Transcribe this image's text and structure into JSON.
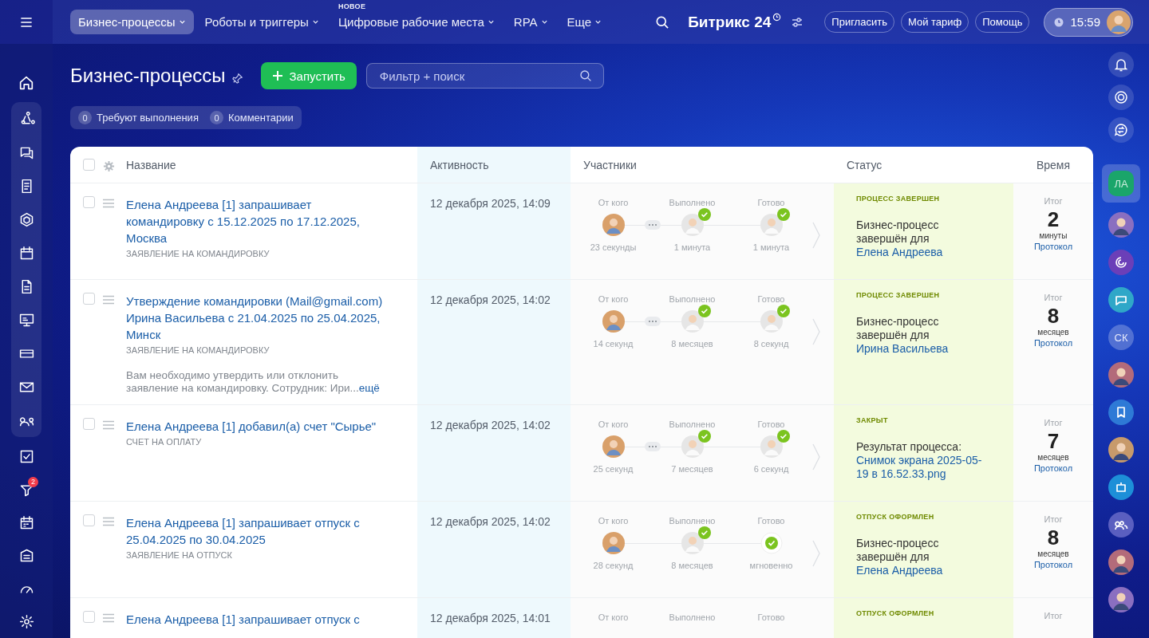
{
  "top_bar": {
    "nav": [
      {
        "label": "Бизнес-процессы",
        "selected": true
      },
      {
        "label": "Роботы и триггеры",
        "selected": false
      },
      {
        "label": "Цифровые рабочие места",
        "selected": false,
        "tag": "НОВОЕ"
      },
      {
        "label": "RPA",
        "selected": false
      },
      {
        "label": "Еще",
        "selected": false
      }
    ],
    "logo": "Битрикс 24",
    "buttons": [
      "Пригласить",
      "Мой тариф",
      "Помощь"
    ],
    "clock": "15:59"
  },
  "left_sidebar": {
    "counter_badge": "2"
  },
  "page": {
    "title": "Бизнес-процессы",
    "start_button": "Запустить",
    "search": {
      "placeholder": "Фильтр + поиск"
    },
    "counters": [
      {
        "count": "0",
        "label": "Требуют выполнения"
      },
      {
        "count": "0",
        "label": "Комментарии"
      }
    ]
  },
  "table": {
    "header_checkbox": {
      "checked": false
    },
    "columns": [
      "Название",
      "Активность",
      "Участники",
      "Статус",
      "Время"
    ],
    "rows": [
      {
        "checked": false,
        "title": "Елена Андреева [1] запрашивает командировку с 15.12.2025 по 17.12.2025, Москва",
        "type": "ЗАЯВЛЕНИЕ НА КОМАНДИРОВКУ",
        "activity": "12 декабря 2025, 14:09",
        "dots": true,
        "steps": [
          {
            "label": "От кого",
            "kind": "person",
            "done": false,
            "time": "23 секунды"
          },
          {
            "label": "Выполнено",
            "kind": "person",
            "done": true,
            "time": "1 минута"
          },
          {
            "label": "Готово",
            "kind": "person",
            "done": true,
            "time": "1 минута"
          }
        ],
        "status": {
          "label": "ПРОЦЕСС ЗАВЕРШЕН",
          "kind": "person",
          "text": "Бизнес-процесс завершён для",
          "link": "Елена Андреева"
        },
        "time": {
          "label": "Итог",
          "value": "2",
          "unit": "минуты",
          "link": "Протокол"
        }
      },
      {
        "checked": false,
        "title": "Утверждение командировки (Mail@gmail.com) Ирина Васильева с 21.04.2025 по 25.04.2025, Минск",
        "type": "ЗАЯВЛЕНИЕ НА КОМАНДИРОВКУ",
        "description": "Вам необходимо утвердить или отклонить заявление на командировку. Сотрудник: Ири...",
        "more": "ещё",
        "activity": "12 декабря 2025, 14:02",
        "dots": true,
        "steps": [
          {
            "label": "От кого",
            "kind": "person",
            "done": false,
            "time": "14 секунд"
          },
          {
            "label": "Выполнено",
            "kind": "person",
            "done": true,
            "time": "8 месяцев"
          },
          {
            "label": "Готово",
            "kind": "person",
            "done": true,
            "time": "8 секунд"
          }
        ],
        "status": {
          "label": "ПРОЦЕСС ЗАВЕРШЕН",
          "kind": "person",
          "text": "Бизнес-процесс завершён для",
          "link": "Ирина Васильева"
        },
        "time": {
          "label": "Итог",
          "value": "8",
          "unit": "месяцев",
          "link": "Протокол"
        }
      },
      {
        "checked": false,
        "title": "Елена Андреева [1] добавил(а) счет \"Сырье\"",
        "type": "СЧЕТ НА ОПЛАТУ",
        "activity": "12 декабря 2025, 14:02",
        "dots": true,
        "steps": [
          {
            "label": "От кого",
            "kind": "person",
            "done": false,
            "time": "25 секунд"
          },
          {
            "label": "Выполнено",
            "kind": "person",
            "done": true,
            "time": "7 месяцев"
          },
          {
            "label": "Готово",
            "kind": "person",
            "done": true,
            "time": "6 секунд"
          }
        ],
        "status": {
          "label": "ЗАКРЫТ",
          "kind": "file",
          "text": "Результат процесса:",
          "link": "Снимок экрана 2025-05-19 в 16.52.33.png"
        },
        "time": {
          "label": "Итог",
          "value": "7",
          "unit": "месяцев",
          "link": "Протокол"
        }
      },
      {
        "checked": false,
        "title": "Елена Андреева [1] запрашивает отпуск с 25.04.2025 по 30.04.2025",
        "type": "ЗАЯВЛЕНИЕ НА ОТПУСК",
        "activity": "12 декабря 2025, 14:02",
        "dots": false,
        "steps": [
          {
            "label": "От кого",
            "kind": "person",
            "done": false,
            "time": "28 секунд"
          },
          {
            "label": "Выполнено",
            "kind": "person",
            "done": true,
            "time": "8 месяцев"
          },
          {
            "label": "Готово",
            "kind": "check",
            "done": false,
            "time": "мгновенно"
          }
        ],
        "status": {
          "label": "ОТПУСК ОФОРМЛЕН",
          "kind": "person",
          "text": "Бизнес-процесс завершён для",
          "link": "Елена Андреева"
        },
        "time": {
          "label": "Итог",
          "value": "8",
          "unit": "месяцев",
          "link": "Протокол"
        }
      },
      {
        "checked": false,
        "title": "Елена Андреева [1] запрашивает отпуск с",
        "activity": "12 декабря 2025, 14:01",
        "steps": [
          {
            "label": "От кого"
          },
          {
            "label": "Выполнено"
          },
          {
            "label": "Готово"
          }
        ],
        "status": {
          "label": "ОТПУСК ОФОРМЛЕН"
        },
        "time": {
          "label": "Итог"
        }
      }
    ]
  },
  "right_sidebar": {
    "items": [
      {
        "kind": "initials",
        "text": "ЛА",
        "selected": true
      },
      {
        "kind": "photo",
        "selected": false
      },
      {
        "kind": "channel",
        "selected": false
      },
      {
        "kind": "chat",
        "selected": false
      },
      {
        "kind": "initials",
        "text": "СК",
        "selected": false
      },
      {
        "kind": "photo",
        "selected": false
      },
      {
        "kind": "bookmark",
        "selected": false
      },
      {
        "kind": "photo",
        "selected": false
      },
      {
        "kind": "bot",
        "selected": false
      },
      {
        "kind": "group",
        "selected": false
      },
      {
        "kind": "photo",
        "selected": false
      },
      {
        "kind": "photo",
        "selected": false
      }
    ]
  }
}
